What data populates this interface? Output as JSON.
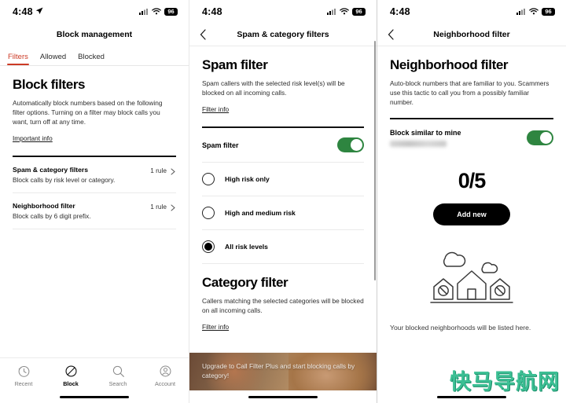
{
  "panel1": {
    "status": {
      "time": "4:48",
      "location_icon": "location-arrow-icon",
      "battery": "96"
    },
    "nav_title": "Block management",
    "tabs": [
      {
        "label": "Filters",
        "active": true
      },
      {
        "label": "Allowed",
        "active": false
      },
      {
        "label": "Blocked",
        "active": false
      }
    ],
    "section_title": "Block filters",
    "section_desc": "Automatically block numbers based on the following filter options. Turning on a filter may block calls you want, turn off at any time.",
    "important_info_link": "Important info",
    "rows": [
      {
        "title": "Spam & category filters",
        "subtitle": "Block calls by risk level or category.",
        "value": "1 rule"
      },
      {
        "title": "Neighborhood filter",
        "subtitle": "Block calls by 6 digit prefix.",
        "value": "1 rule"
      }
    ],
    "tabbar": [
      {
        "label": "Recent",
        "icon": "recent-clock-icon",
        "active": false
      },
      {
        "label": "Block",
        "icon": "block-circle-slash-icon",
        "active": true
      },
      {
        "label": "Search",
        "icon": "search-magnifier-icon",
        "active": false
      },
      {
        "label": "Account",
        "icon": "account-person-icon",
        "active": false
      }
    ]
  },
  "panel2": {
    "status": {
      "time": "4:48",
      "battery": "96"
    },
    "nav_title": "Spam & category filters",
    "back_icon": "chevron-left-icon",
    "spam": {
      "title": "Spam filter",
      "desc": "Spam callers with the selected risk level(s) will be blocked on all incoming calls.",
      "filter_info_link": "Filter info",
      "toggle_label": "Spam filter",
      "toggle_on": true,
      "options": [
        {
          "label": "High risk only",
          "selected": false
        },
        {
          "label": "High and medium risk",
          "selected": false
        },
        {
          "label": "All risk levels",
          "selected": true
        }
      ]
    },
    "category": {
      "title": "Category filter",
      "desc": "Callers matching the selected categories will be blocked on all incoming calls.",
      "filter_info_link": "Filter info"
    },
    "promo": {
      "text": "Upgrade to Call Filter Plus and start blocking calls by category!"
    }
  },
  "panel3": {
    "status": {
      "time": "4:48",
      "battery": "96"
    },
    "nav_title": "Neighborhood filter",
    "back_icon": "chevron-left-icon",
    "section_title": "Neighborhood filter",
    "section_desc": "Auto-block numbers that are familiar to you. Scammers use this tactic to call you from a possibly familiar number.",
    "toggle_label": "Block similar to mine",
    "toggle_on": true,
    "count": "0/5",
    "add_new_label": "Add new",
    "illustration": "neighborhood-houses-blocked-icon",
    "empty_text": "Your blocked neighborhoods will be listed here."
  },
  "watermark": {
    "text": "快马导航网"
  },
  "colors": {
    "accent_red": "#cc3a25",
    "toggle_green": "#2e8540",
    "black": "#000000",
    "watermark_green": "#3cbf94"
  }
}
